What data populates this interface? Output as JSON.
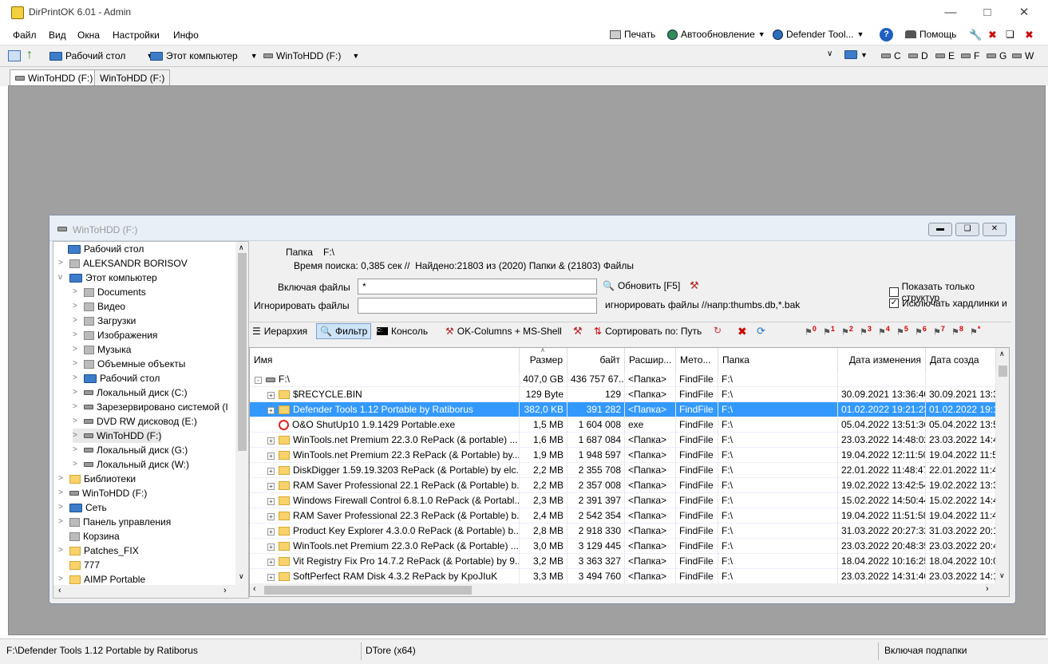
{
  "app": {
    "title": "DirPrintOK 6.01 - Admin"
  },
  "menu": [
    "Файл",
    "Вид",
    "Окна",
    "Настройки",
    "Инфо"
  ],
  "toolbar": {
    "print": "Печать",
    "autoupdate": "Автообновление",
    "defender": "Defender Tool...",
    "help": "Помощь"
  },
  "toolbar2": {
    "desktop": "Рабочий стол",
    "computer": "Этот компьютер",
    "drive": "WinToHDD (F:)",
    "drives": [
      "C",
      "D",
      "E",
      "F",
      "G",
      "W"
    ]
  },
  "doctabs": [
    "WinToHDD (F:)",
    "WinToHDD (F:)"
  ],
  "child": {
    "title": "WinToHDD (F:)"
  },
  "tree": [
    {
      "label": "Рабочий стол",
      "icon": "monitor-icon",
      "level": 0,
      "expand": ""
    },
    {
      "label": "ALEKSANDR BORISOV",
      "icon": "user-icon",
      "level": 1,
      "expand": ">"
    },
    {
      "label": "Этот компьютер",
      "icon": "monitor-icon",
      "level": 1,
      "expand": "v"
    },
    {
      "label": "Documents",
      "icon": "doc-icon",
      "level": 2,
      "expand": ">"
    },
    {
      "label": "Видео",
      "icon": "video-icon",
      "level": 2,
      "expand": ">"
    },
    {
      "label": "Загрузки",
      "icon": "download-icon",
      "level": 2,
      "expand": ">"
    },
    {
      "label": "Изображения",
      "icon": "image-icon",
      "level": 2,
      "expand": ">"
    },
    {
      "label": "Музыка",
      "icon": "music-icon",
      "level": 2,
      "expand": ">"
    },
    {
      "label": "Объемные объекты",
      "icon": "cube-icon",
      "level": 2,
      "expand": ">"
    },
    {
      "label": "Рабочий стол",
      "icon": "monitor-icon",
      "level": 2,
      "expand": ">"
    },
    {
      "label": "Локальный диск (C:)",
      "icon": "drive-icon",
      "level": 2,
      "expand": ">"
    },
    {
      "label": "Зарезервировано системой (I",
      "icon": "drive-icon",
      "level": 2,
      "expand": ">"
    },
    {
      "label": "DVD RW дисковод (E:)",
      "icon": "dvd-icon",
      "level": 2,
      "expand": ">"
    },
    {
      "label": "WinToHDD (F:)",
      "icon": "drive-icon",
      "level": 2,
      "expand": ">"
    },
    {
      "label": "Локальный диск (G:)",
      "icon": "drive-icon",
      "level": 2,
      "expand": ">"
    },
    {
      "label": "Локальный диск (W:)",
      "icon": "drive-icon",
      "level": 2,
      "expand": ">"
    },
    {
      "label": "Библиотеки",
      "icon": "folder-icon",
      "level": 1,
      "expand": ">"
    },
    {
      "label": "WinToHDD (F:)",
      "icon": "drive-icon",
      "level": 1,
      "expand": ">"
    },
    {
      "label": "Сеть",
      "icon": "network-icon",
      "level": 1,
      "expand": ">"
    },
    {
      "label": "Панель управления",
      "icon": "control-panel-icon",
      "level": 1,
      "expand": ">"
    },
    {
      "label": "Корзина",
      "icon": "recycle-icon",
      "level": 1,
      "expand": ""
    },
    {
      "label": "Patches_FIX",
      "icon": "folder-icon",
      "level": 1,
      "expand": ">"
    },
    {
      "label": "777",
      "icon": "folder-icon",
      "level": 1,
      "expand": ""
    },
    {
      "label": "AIMP Portable",
      "icon": "aimp-icon",
      "level": 1,
      "expand": ">"
    }
  ],
  "info": {
    "folder_label": "Папка",
    "folder_value": "F:\\",
    "search_time": "Время поиска: 0,385 сек //  Найдено:21803 из (2020) Папки & (21803) Файлы",
    "include_label": "Включая файлы",
    "include_value": "*",
    "refresh": "Обновить [F5]",
    "ignore_label": "Игнорировать файлы",
    "ignore_value": "",
    "ignore_hint": "игнорировать файлы //напр:thumbs.db,*.bak",
    "show_structure": "Показать только структур",
    "show_structure_checked": false,
    "exclude_hardlinks": "Исключать хардлинки и",
    "exclude_hardlinks_checked": true
  },
  "filterbar": {
    "hierarchy": "Иерархия",
    "filter": "Фильтр",
    "console": "Консоль",
    "okcolumns": "OK-Columns + MS-Shell",
    "sort": "Сортировать по: Путь"
  },
  "grid": {
    "headers": [
      "Имя",
      "Размер",
      "байт",
      "Расшир...",
      "Мето...",
      "Папка",
      "Дата изменения",
      "Дата созда"
    ],
    "root": {
      "name": "F:\\",
      "size": "407,0 GB",
      "bytes": "436 757 67...",
      "ext": "<Папка>",
      "method": "FindFile",
      "folder": "F:\\",
      "modified": "",
      "created": ""
    },
    "rows": [
      {
        "name": "$RECYCLE.BIN",
        "size": "129 Byte",
        "bytes": "129",
        "ext": "<Папка>",
        "method": "FindFile",
        "folder": "F:\\",
        "modified": "30.09.2021 13:36:40",
        "created": "30.09.2021 13:3",
        "icon": "folder",
        "selected": false
      },
      {
        "name": "Defender Tools 1.12 Portable by Ratiborus",
        "size": "382,0 KB",
        "bytes": "391 282",
        "ext": "<Папка>",
        "method": "FindFile",
        "folder": "F:\\",
        "modified": "01.02.2022 19:21:23",
        "created": "01.02.2022 19:1",
        "icon": "folder",
        "selected": true
      },
      {
        "name": "O&O ShutUp10 1.9.1429 Portable.exe",
        "size": "1,5 MB",
        "bytes": "1 604 008",
        "ext": "exe",
        "method": "FindFile",
        "folder": "F:\\",
        "modified": "05.04.2022 13:51:36",
        "created": "05.04.2022 13:5",
        "icon": "exe",
        "selected": false
      },
      {
        "name": "WinTools.net Premium 22.3.0 RePack (& portable) ...",
        "size": "1,6 MB",
        "bytes": "1 687 084",
        "ext": "<Папка>",
        "method": "FindFile",
        "folder": "F:\\",
        "modified": "23.03.2022 14:48:02",
        "created": "23.03.2022 14:4",
        "icon": "folder",
        "selected": false
      },
      {
        "name": "WinTools.net Premium 22.3 RePack (& Portable) by...",
        "size": "1,9 MB",
        "bytes": "1 948 597",
        "ext": "<Папка>",
        "method": "FindFile",
        "folder": "F:\\",
        "modified": "19.04.2022 12:11:50",
        "created": "19.04.2022 11:5",
        "icon": "folder",
        "selected": false
      },
      {
        "name": "DiskDigger 1.59.19.3203 RePack (& Portable) by elc...",
        "size": "2,2 MB",
        "bytes": "2 355 708",
        "ext": "<Папка>",
        "method": "FindFile",
        "folder": "F:\\",
        "modified": "22.01.2022 11:48:47",
        "created": "22.01.2022 11:4",
        "icon": "folder",
        "selected": false
      },
      {
        "name": "RAM Saver Professional 22.1 RePack (& Portable) b...",
        "size": "2,2 MB",
        "bytes": "2 357 008",
        "ext": "<Папка>",
        "method": "FindFile",
        "folder": "F:\\",
        "modified": "19.02.2022 13:42:54",
        "created": "19.02.2022 13:3",
        "icon": "folder",
        "selected": false
      },
      {
        "name": "Windows Firewall Control 6.8.1.0 RePack (& Portabl...",
        "size": "2,3 MB",
        "bytes": "2 391 397",
        "ext": "<Папка>",
        "method": "FindFile",
        "folder": "F:\\",
        "modified": "15.02.2022 14:50:44",
        "created": "15.02.2022 14:4",
        "icon": "folder",
        "selected": false
      },
      {
        "name": "RAM Saver Professional 22.3 RePack (& Portable) b...",
        "size": "2,4 MB",
        "bytes": "2 542 354",
        "ext": "<Папка>",
        "method": "FindFile",
        "folder": "F:\\",
        "modified": "19.04.2022 11:51:58",
        "created": "19.04.2022 11:4",
        "icon": "folder",
        "selected": false
      },
      {
        "name": "Product Key Explorer 4.3.0.0 RePack (& Portable) b...",
        "size": "2,8 MB",
        "bytes": "2 918 330",
        "ext": "<Папка>",
        "method": "FindFile",
        "folder": "F:\\",
        "modified": "31.03.2022 20:27:32",
        "created": "31.03.2022 20:1",
        "icon": "folder",
        "selected": false
      },
      {
        "name": "WinTools.net Premium 22.3.0 RePack (& Portable) ...",
        "size": "3,0 MB",
        "bytes": "3 129 445",
        "ext": "<Папка>",
        "method": "FindFile",
        "folder": "F:\\",
        "modified": "23.03.2022 20:48:35",
        "created": "23.03.2022 20:4",
        "icon": "folder",
        "selected": false
      },
      {
        "name": "Vit Registry Fix Pro 14.7.2 RePack (& Portable) by 9...",
        "size": "3,2 MB",
        "bytes": "3 363 327",
        "ext": "<Папка>",
        "method": "FindFile",
        "folder": "F:\\",
        "modified": "18.04.2022 10:16:25",
        "created": "18.04.2022 10:0",
        "icon": "folder",
        "selected": false
      },
      {
        "name": "SoftPerfect RAM Disk 4.3.2 RePack by KpoJIuK",
        "size": "3,3 MB",
        "bytes": "3 494 760",
        "ext": "<Папка>",
        "method": "FindFile",
        "folder": "F:\\",
        "modified": "23.03.2022 14:31:46",
        "created": "23.03.2022 14:1",
        "icon": "folder",
        "selected": false
      }
    ]
  },
  "status": {
    "path": "F:\\Defender Tools 1.12 Portable by Ratiborus",
    "middle": "DTore (x64)",
    "right": "Включая подпапки"
  },
  "colors": {
    "selection": "#3399ff",
    "mdi_bg": "#a0a0a0",
    "folder": "#f8d26b",
    "accent": "#1e5fbf"
  }
}
